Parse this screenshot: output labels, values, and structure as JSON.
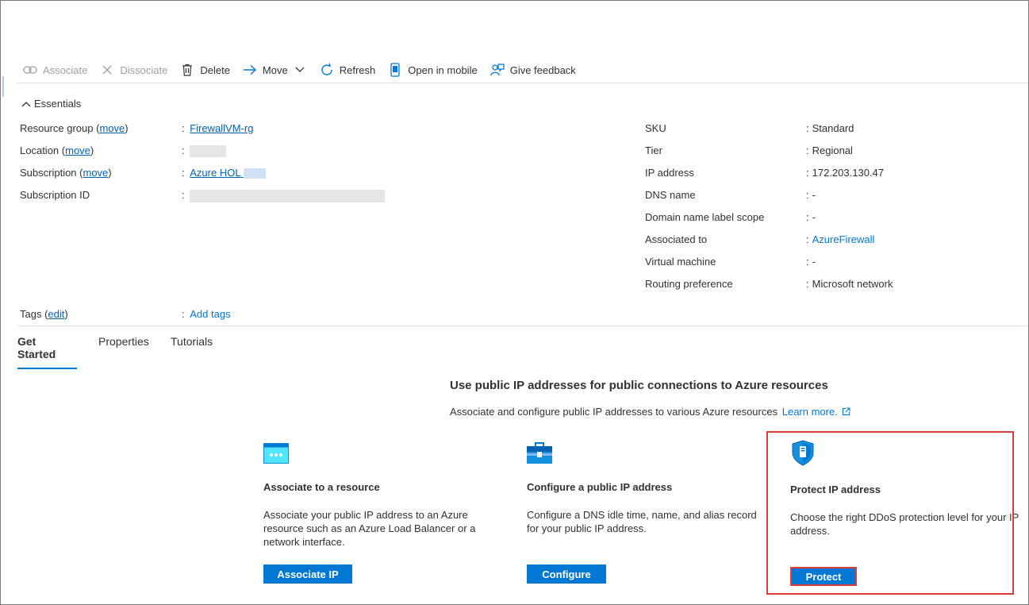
{
  "toolbar": {
    "associate": "Associate",
    "dissociate": "Dissociate",
    "delete": "Delete",
    "move": "Move",
    "refresh": "Refresh",
    "open_mobile": "Open in mobile",
    "feedback": "Give feedback"
  },
  "essentials": {
    "header": "Essentials",
    "left": {
      "resource_group_key": "Resource group",
      "move_link": "move",
      "resource_group_value": "FirewallVM-rg",
      "location_key": "Location",
      "subscription_key": "Subscription",
      "subscription_value": "Azure HOL",
      "subscription_id_key": "Subscription ID",
      "tags_key": "Tags",
      "edit_link": "edit",
      "tags_value": "Add tags"
    },
    "right": [
      {
        "key": "SKU",
        "value": "Standard",
        "link": false
      },
      {
        "key": "Tier",
        "value": "Regional",
        "link": false
      },
      {
        "key": "IP address",
        "value": "172.203.130.47",
        "link": false
      },
      {
        "key": "DNS name",
        "value": "-",
        "link": false
      },
      {
        "key": "Domain name label scope",
        "value": "-",
        "link": false
      },
      {
        "key": "Associated to",
        "value": "AzureFirewall",
        "link": true
      },
      {
        "key": "Virtual machine",
        "value": "-",
        "link": false
      },
      {
        "key": "Routing preference",
        "value": "Microsoft network",
        "link": false
      }
    ],
    "colon": ":"
  },
  "tabs": [
    "Get Started",
    "Properties",
    "Tutorials"
  ],
  "get_started": {
    "title": "Use public IP addresses for public connections to Azure resources",
    "subtitle": "Associate and configure public IP addresses to various Azure resources",
    "learn_more": "Learn more.",
    "cards": [
      {
        "title": "Associate to a resource",
        "desc": "Associate your public IP address to an Azure resource such as an Azure Load Balancer or a network interface.",
        "button": "Associate IP"
      },
      {
        "title": "Configure a public IP address",
        "desc": "Configure a DNS idle time, name, and alias record for your public IP address.",
        "button": "Configure"
      },
      {
        "title": "Protect IP address",
        "desc": "Choose the right DDoS protection level for your IP address.",
        "button": "Protect"
      }
    ]
  },
  "colors": {
    "accent": "#0078d4",
    "link": "#0063b1",
    "highlight": "#e03a3a"
  }
}
